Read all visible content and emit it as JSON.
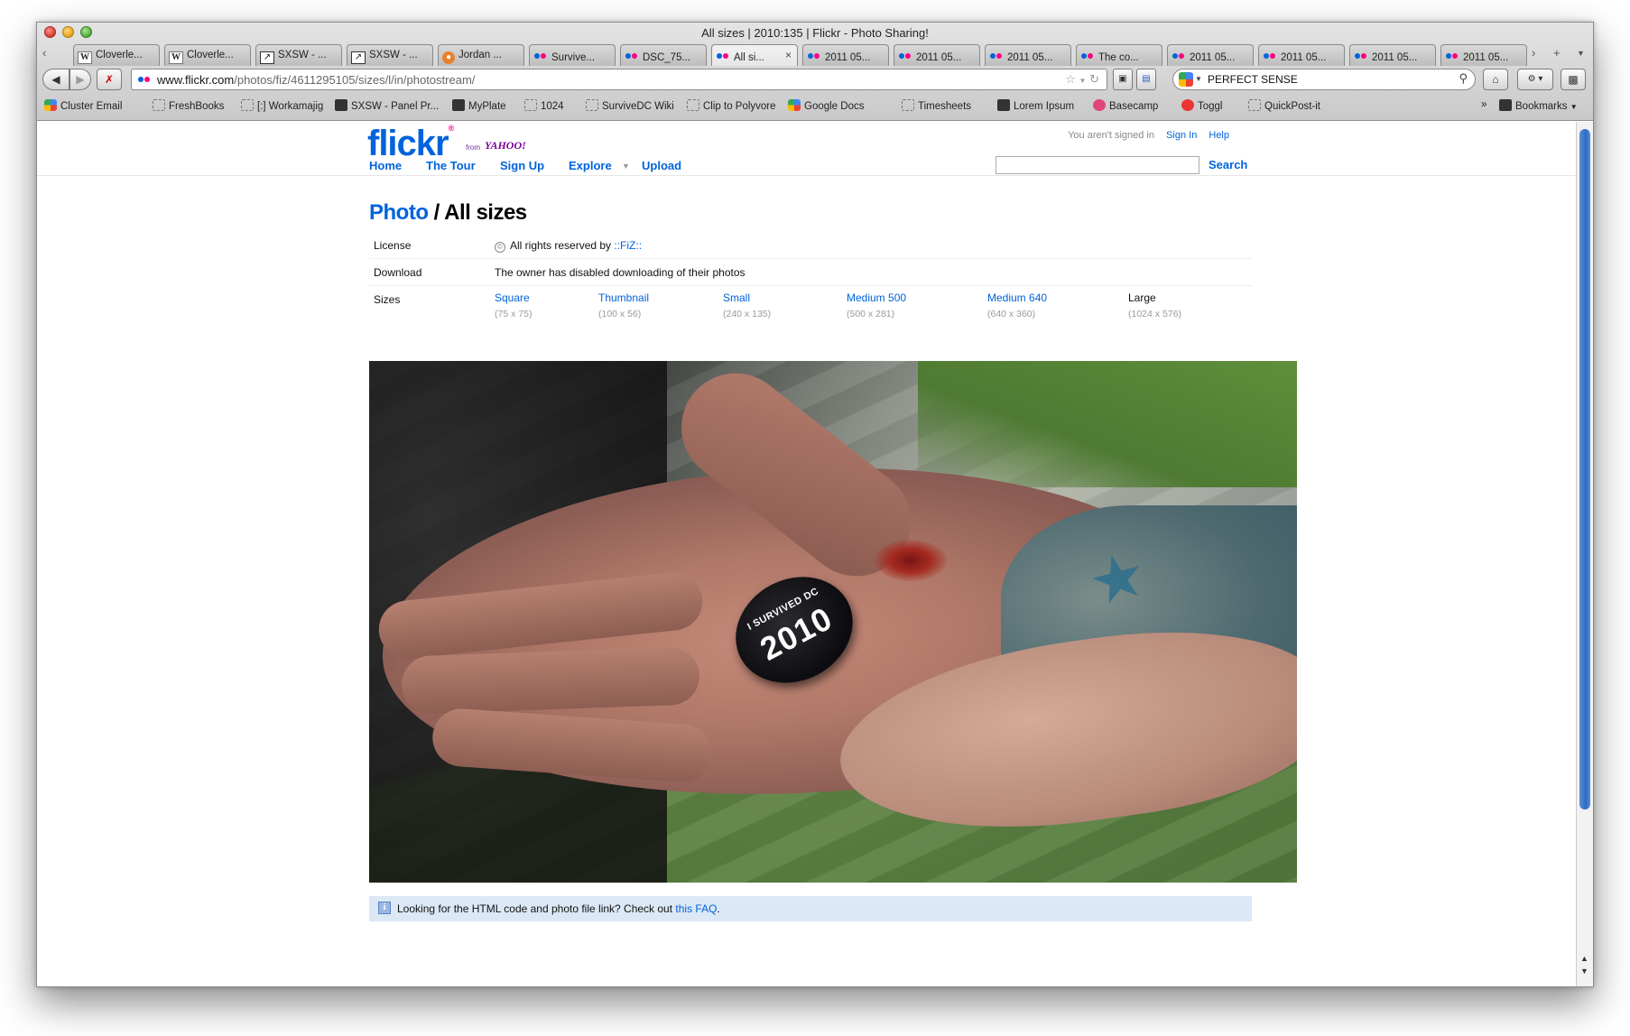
{
  "window": {
    "title": "All sizes | 2010:135 | Flickr - Photo Sharing!"
  },
  "tabs": [
    {
      "label": "Cloverle...",
      "icon": "wikipedia-icon"
    },
    {
      "label": "Cloverle...",
      "icon": "wikipedia-icon"
    },
    {
      "label": "SXSW - ...",
      "icon": "panelpicker-icon"
    },
    {
      "label": "SXSW - ...",
      "icon": "panelpicker-icon"
    },
    {
      "label": "Jordan ...",
      "icon": "orange-circle-icon"
    },
    {
      "label": "Survive...",
      "icon": "flickr-icon"
    },
    {
      "label": "DSC_75...",
      "icon": "flickr-icon"
    },
    {
      "label": "All si...",
      "icon": "flickr-icon",
      "active": true
    },
    {
      "label": "2011 05...",
      "icon": "flickr-icon"
    },
    {
      "label": "2011 05...",
      "icon": "flickr-icon"
    },
    {
      "label": "2011 05...",
      "icon": "flickr-icon"
    },
    {
      "label": "The co...",
      "icon": "flickr-icon"
    },
    {
      "label": "2011 05...",
      "icon": "flickr-icon"
    },
    {
      "label": "2011 05...",
      "icon": "flickr-icon"
    },
    {
      "label": "2011 05...",
      "icon": "flickr-icon"
    },
    {
      "label": "2011 05...",
      "icon": "flickr-icon"
    }
  ],
  "nav": {
    "url_host": "www.flickr.com",
    "url_path": "/photos/fiz/4611295105/sizes/l/in/photostream/",
    "search_value": "PERFECT SENSE"
  },
  "bookmarks": [
    {
      "label": "Cluster Email"
    },
    {
      "label": "FreshBooks"
    },
    {
      "label": "[:] Workamajig"
    },
    {
      "label": "SXSW - Panel Pr..."
    },
    {
      "label": "MyPlate"
    },
    {
      "label": "1024"
    },
    {
      "label": "SurviveDC Wiki"
    },
    {
      "label": "Clip to Polyvore"
    },
    {
      "label": "Google Docs"
    },
    {
      "label": "Timesheets"
    },
    {
      "label": "Lorem Ipsum"
    },
    {
      "label": "Basecamp"
    },
    {
      "label": "Toggl"
    },
    {
      "label": "QuickPost-it"
    }
  ],
  "bookmarks_menu": "Bookmarks",
  "flickr": {
    "logo_text": "flickr",
    "logo_from": "from",
    "logo_yahoo": "YAHOO!",
    "menu": {
      "home": "Home",
      "tour": "The Tour",
      "signup": "Sign Up",
      "explore": "Explore",
      "upload": "Upload"
    },
    "not_signed_in": "You aren't signed in",
    "sign_in": "Sign In",
    "help": "Help",
    "search_button": "Search"
  },
  "page": {
    "breadcrumb_link": "Photo",
    "separator": " / ",
    "title": "All sizes",
    "license_label": "License",
    "license_text": "All rights reserved by ",
    "license_owner": "::FiZ::",
    "download_label": "Download",
    "download_text": "The owner has disabled downloading of their photos",
    "sizes_label": "Sizes",
    "sizes": [
      {
        "name": "Square",
        "dims": "(75 x 75)"
      },
      {
        "name": "Thumbnail",
        "dims": "(100 x 56)"
      },
      {
        "name": "Small",
        "dims": "(240 x 135)"
      },
      {
        "name": "Medium 500",
        "dims": "(500 x 281)"
      },
      {
        "name": "Medium 640",
        "dims": "(640 x 360)"
      },
      {
        "name": "Large",
        "dims": "(1024 x 576)",
        "current": true
      }
    ],
    "pin_line1": "I SURVIVED DC",
    "pin_line2": "2010",
    "faq_text": "Looking for the HTML code and photo file link? Check out ",
    "faq_link": "this FAQ",
    "faq_end": "."
  },
  "colors": {
    "flickr_blue": "#0063dc",
    "flickr_pink": "#ff0084",
    "faq_bg": "#dce8f6"
  }
}
